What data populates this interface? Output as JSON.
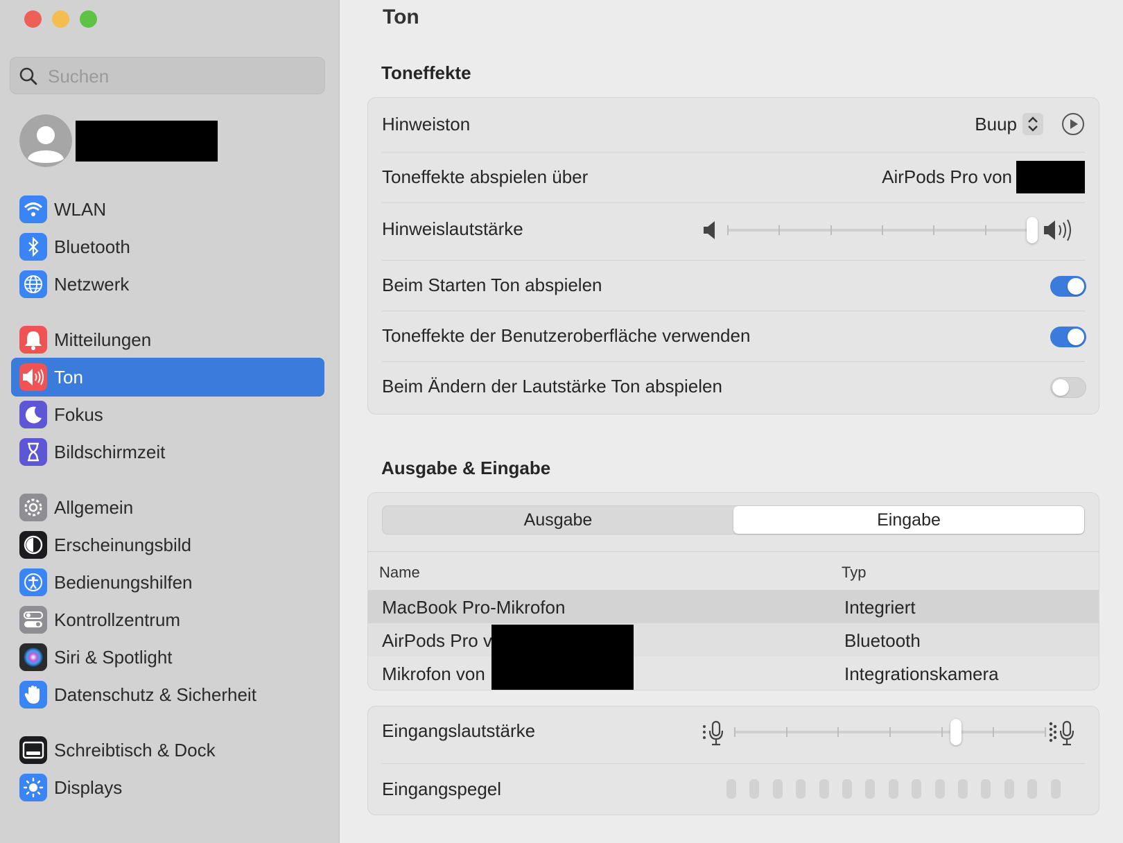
{
  "sidebar": {
    "search_placeholder": "Suchen",
    "items": [
      {
        "label": "WLAN",
        "icon": "wifi-icon",
        "color": "#3a85f3"
      },
      {
        "label": "Bluetooth",
        "icon": "bluetooth-icon",
        "color": "#3a85f3"
      },
      {
        "label": "Netzwerk",
        "icon": "globe-icon",
        "color": "#3a85f3"
      },
      {
        "label": "Mitteilungen",
        "icon": "bell-icon",
        "color": "#ef5353"
      },
      {
        "label": "Ton",
        "icon": "speaker-icon",
        "color": "#ef5353"
      },
      {
        "label": "Fokus",
        "icon": "moon-icon",
        "color": "#5d57d6"
      },
      {
        "label": "Bildschirmzeit",
        "icon": "hourglass-icon",
        "color": "#5d57d6"
      },
      {
        "label": "Allgemein",
        "icon": "gear-icon",
        "color": "#8e8e93"
      },
      {
        "label": "Erscheinungsbild",
        "icon": "appearance-icon",
        "color": "#1c1c1e"
      },
      {
        "label": "Bedienungshilfen",
        "icon": "accessibility-icon",
        "color": "#3a85f3"
      },
      {
        "label": "Kontrollzentrum",
        "icon": "control-center-icon",
        "color": "#8e8e93"
      },
      {
        "label": "Siri & Spotlight",
        "icon": "siri-icon",
        "color": "#2b2b2b"
      },
      {
        "label": "Datenschutz & Sicherheit",
        "icon": "hand-icon",
        "color": "#3a85f3"
      },
      {
        "label": "Schreibtisch & Dock",
        "icon": "dock-icon",
        "color": "#1c1c1e"
      },
      {
        "label": "Displays",
        "icon": "sun-icon",
        "color": "#3a85f3"
      }
    ],
    "active_index": 4
  },
  "main": {
    "title": "Ton",
    "effects": {
      "title": "Toneffekte",
      "alert_sound_label": "Hinweiston",
      "alert_sound_value": "Buup",
      "play_through_label": "Toneffekte abspielen über",
      "play_through_value": "AirPods Pro von",
      "alert_volume_label": "Hinweislautstärke",
      "alert_volume_level": 1.0,
      "startup_label": "Beim Starten Ton abspielen",
      "startup_on": true,
      "ui_effects_label": "Toneffekte der Benutzeroberfläche verwenden",
      "ui_effects_on": true,
      "volume_feedback_label": "Beim Ändern der Lautstärke Ton abspielen",
      "volume_feedback_on": false
    },
    "io": {
      "title": "Ausgabe & Eingabe",
      "tabs": [
        "Ausgabe",
        "Eingabe"
      ],
      "selected_tab": 1,
      "columns": [
        "Name",
        "Typ"
      ],
      "devices": [
        {
          "name": "MacBook Pro-Mikrofon",
          "type": "Integriert",
          "selected": true
        },
        {
          "name": "AirPods Pro v",
          "type": "Bluetooth",
          "selected": false
        },
        {
          "name": "Mikrofon von",
          "type": "Integrationskamera",
          "selected": false
        }
      ],
      "input_volume_label": "Eingangslautstärke",
      "input_volume_level": 0.72,
      "input_level_label": "Eingangspegel",
      "input_level_value": 0
    }
  }
}
